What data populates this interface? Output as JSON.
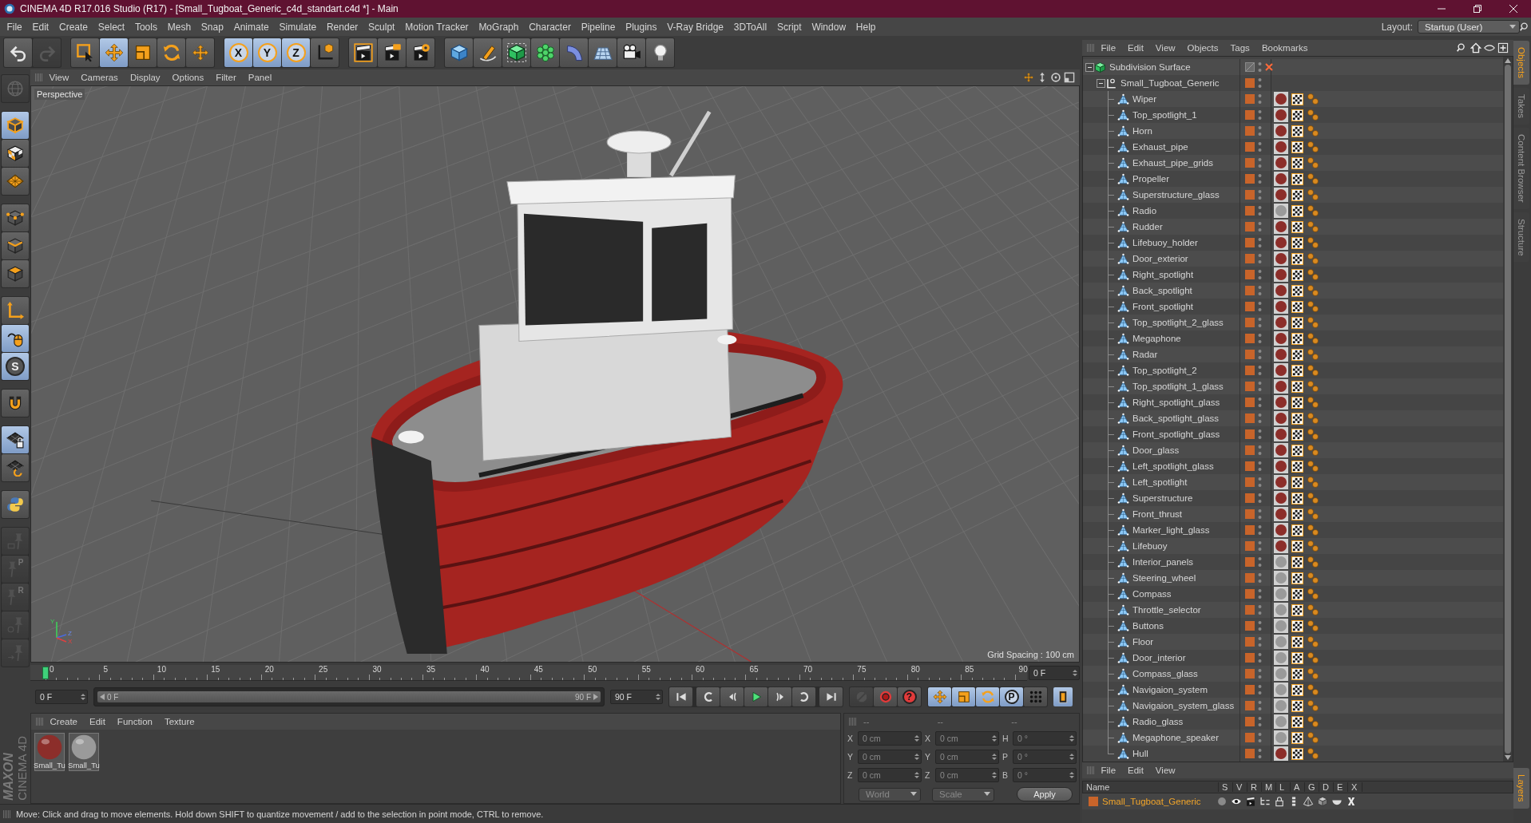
{
  "window": {
    "title": "CINEMA 4D R17.016 Studio (R17) - [Small_Tugboat_Generic_c4d_standart.c4d *] - Main"
  },
  "menu": [
    "File",
    "Edit",
    "Create",
    "Select",
    "Tools",
    "Mesh",
    "Snap",
    "Animate",
    "Simulate",
    "Render",
    "Sculpt",
    "Motion Tracker",
    "MoGraph",
    "Character",
    "Pipeline",
    "Plugins",
    "V-Ray Bridge",
    "3DToAll",
    "Script",
    "Window",
    "Help"
  ],
  "layout": {
    "label": "Layout:",
    "value": "Startup (User)"
  },
  "toolbar": [
    [
      {
        "selected": false,
        "disabled": false
      },
      {
        "selected": false,
        "disabled": true
      }
    ],
    [
      {
        "selected": false,
        "disabled": false
      },
      {
        "selected": true,
        "disabled": false
      },
      {
        "selected": false,
        "disabled": false
      },
      {
        "selected": false,
        "disabled": false
      },
      {
        "selected": false,
        "disabled": false
      }
    ],
    [
      {
        "label": "X",
        "selected": true,
        "disabled": false
      },
      {
        "label": "Y",
        "selected": true,
        "disabled": false
      },
      {
        "label": "Z",
        "selected": true,
        "disabled": false
      },
      {
        "selected": false,
        "disabled": false
      }
    ],
    [
      {
        "selected": false,
        "disabled": false
      },
      {
        "selected": false,
        "disabled": false
      },
      {
        "selected": false,
        "disabled": false
      }
    ],
    [
      {
        "selected": false,
        "disabled": false
      },
      {
        "selected": false,
        "disabled": false
      },
      {
        "selected": false,
        "disabled": false
      },
      {
        "selected": false,
        "disabled": false
      },
      {
        "selected": false,
        "disabled": false
      },
      {
        "selected": false,
        "disabled": false
      },
      {
        "selected": false,
        "disabled": false
      },
      {
        "selected": false,
        "disabled": false
      }
    ]
  ],
  "tools": [
    [
      {
        "selected": false,
        "disabled": true
      }
    ],
    [
      {
        "selected": true,
        "disabled": false
      },
      {
        "selected": false,
        "disabled": false
      },
      {
        "selected": false,
        "disabled": false
      }
    ],
    [
      {
        "selected": false,
        "disabled": false
      },
      {
        "selected": false,
        "disabled": false
      },
      {
        "selected": false,
        "disabled": false
      }
    ],
    [
      {
        "selected": false,
        "disabled": false
      },
      {
        "selected": true,
        "disabled": false
      },
      {
        "label": "S",
        "selected": true,
        "disabled": false
      }
    ],
    [
      {
        "selected": false,
        "disabled": false
      }
    ],
    [
      {
        "selected": true,
        "disabled": false
      },
      {
        "selected": false,
        "disabled": false
      }
    ],
    [
      {
        "selected": false,
        "disabled": false
      }
    ],
    [
      {
        "selected": false,
        "disabled": true
      },
      {
        "label": "P",
        "selected": false,
        "disabled": true
      },
      {
        "label": "R",
        "selected": false,
        "disabled": true
      },
      {
        "selected": false,
        "disabled": true
      },
      {
        "selected": false,
        "disabled": true
      }
    ]
  ],
  "logo": {
    "brand": "MAXON",
    "product": "CINEMA 4D"
  },
  "viewport": {
    "menu": [
      "View",
      "Cameras",
      "Display",
      "Options",
      "Filter",
      "Panel"
    ],
    "label": "Perspective",
    "grid_spacing": "Grid Spacing : 100 cm",
    "axes": [
      "Y",
      "Z",
      "X"
    ]
  },
  "timeline": {
    "ticks": [
      "0",
      "5",
      "10",
      "15",
      "20",
      "25",
      "30",
      "35",
      "40",
      "45",
      "50",
      "55",
      "60",
      "65",
      "70",
      "75",
      "80",
      "85",
      "90"
    ],
    "playhead": {
      "level": 0
    },
    "frame": "0 F"
  },
  "playback": {
    "start": "0 F",
    "range": {
      "start": "0 F",
      "end": "90 F",
      "level": 1
    },
    "end": "90 F",
    "record": [
      {
        "disabled": true
      },
      {
        "disabled": false
      },
      {
        "label": "?",
        "disabled": false
      }
    ],
    "keys": [
      {
        "selected": true
      },
      {
        "selected": true
      },
      {
        "selected": true
      },
      {
        "label": "P",
        "selected": true
      },
      {
        "selected": false
      }
    ],
    "timeline_toggle": {
      "selected": true
    }
  },
  "materials": {
    "menu": [
      "Create",
      "Edit",
      "Function",
      "Texture"
    ],
    "items": [
      {
        "name": "Small_Tu",
        "color": "#8c2e2a"
      },
      {
        "name": "Small_Tu",
        "color": "#9a9a9a"
      }
    ]
  },
  "coordinates": {
    "headers": [
      "--",
      "--",
      "--"
    ],
    "columns": [
      [
        {
          "label": "X",
          "value": "0 cm"
        },
        {
          "label": "Y",
          "value": "0 cm"
        },
        {
          "label": "Z",
          "value": "0 cm"
        }
      ],
      [
        {
          "label": "X",
          "value": "0 cm"
        },
        {
          "label": "Y",
          "value": "0 cm"
        },
        {
          "label": "Z",
          "value": "0 cm"
        }
      ],
      [
        {
          "label": "H",
          "value": "0 °"
        },
        {
          "label": "P",
          "value": "0 °"
        },
        {
          "label": "B",
          "value": "0 °"
        }
      ]
    ],
    "modes": [
      "World",
      "Scale"
    ],
    "apply": "Apply"
  },
  "status": "Move: Click and drag to move elements. Hold down SHIFT to quantize movement / add to the selection in point mode, CTRL to remove.",
  "object_manager": {
    "menu": [
      "File",
      "Edit",
      "View",
      "Objects",
      "Tags",
      "Bookmarks"
    ],
    "tree": [
      {
        "name": "Subdivision Surface",
        "kind": "generator",
        "enabled": false,
        "expanded": true,
        "children": [
          {
            "name": "Small_Tugboat_Generic",
            "kind": "null",
            "layer": {
              "color": "#c8642a"
            },
            "expanded": true,
            "children": [
              {
                "name": "Wiper",
                "kind": "polygon",
                "layer": {
                  "color": "#c8642a"
                },
                "material": {
                  "color": "#8c2e2a"
                }
              },
              {
                "name": "Top_spotlight_1",
                "kind": "polygon",
                "layer": {
                  "color": "#c8642a"
                },
                "material": {
                  "color": "#8c2e2a"
                }
              },
              {
                "name": "Horn",
                "kind": "polygon",
                "layer": {
                  "color": "#c8642a"
                },
                "material": {
                  "color": "#8c2e2a"
                }
              },
              {
                "name": "Exhaust_pipe",
                "kind": "polygon",
                "layer": {
                  "color": "#c8642a"
                },
                "material": {
                  "color": "#8c2e2a"
                }
              },
              {
                "name": "Exhaust_pipe_grids",
                "kind": "polygon",
                "layer": {
                  "color": "#c8642a"
                },
                "material": {
                  "color": "#8c2e2a"
                }
              },
              {
                "name": "Propeller",
                "kind": "polygon",
                "layer": {
                  "color": "#c8642a"
                },
                "material": {
                  "color": "#8c2e2a"
                }
              },
              {
                "name": "Superstructure_glass",
                "kind": "polygon",
                "layer": {
                  "color": "#c8642a"
                },
                "material": {
                  "color": "#8c2e2a"
                }
              },
              {
                "name": "Radio",
                "kind": "polygon",
                "layer": {
                  "color": "#c8642a"
                },
                "material": {
                  "color": "#9a9a9a"
                }
              },
              {
                "name": "Rudder",
                "kind": "polygon",
                "layer": {
                  "color": "#c8642a"
                },
                "material": {
                  "color": "#8c2e2a"
                }
              },
              {
                "name": "Lifebuoy_holder",
                "kind": "polygon",
                "layer": {
                  "color": "#c8642a"
                },
                "material": {
                  "color": "#8c2e2a"
                }
              },
              {
                "name": "Door_exterior",
                "kind": "polygon",
                "layer": {
                  "color": "#c8642a"
                },
                "material": {
                  "color": "#8c2e2a"
                }
              },
              {
                "name": "Right_spotlight",
                "kind": "polygon",
                "layer": {
                  "color": "#c8642a"
                },
                "material": {
                  "color": "#8c2e2a"
                }
              },
              {
                "name": "Back_spotlight",
                "kind": "polygon",
                "layer": {
                  "color": "#c8642a"
                },
                "material": {
                  "color": "#8c2e2a"
                }
              },
              {
                "name": "Front_spotlight",
                "kind": "polygon",
                "layer": {
                  "color": "#c8642a"
                },
                "material": {
                  "color": "#8c2e2a"
                }
              },
              {
                "name": "Top_spotlight_2_glass",
                "kind": "polygon",
                "layer": {
                  "color": "#c8642a"
                },
                "material": {
                  "color": "#8c2e2a"
                }
              },
              {
                "name": "Megaphone",
                "kind": "polygon",
                "layer": {
                  "color": "#c8642a"
                },
                "material": {
                  "color": "#8c2e2a"
                }
              },
              {
                "name": "Radar",
                "kind": "polygon",
                "layer": {
                  "color": "#c8642a"
                },
                "material": {
                  "color": "#8c2e2a"
                }
              },
              {
                "name": "Top_spotlight_2",
                "kind": "polygon",
                "layer": {
                  "color": "#c8642a"
                },
                "material": {
                  "color": "#8c2e2a"
                }
              },
              {
                "name": "Top_spotlight_1_glass",
                "kind": "polygon",
                "layer": {
                  "color": "#c8642a"
                },
                "material": {
                  "color": "#8c2e2a"
                }
              },
              {
                "name": "Right_spotlight_glass",
                "kind": "polygon",
                "layer": {
                  "color": "#c8642a"
                },
                "material": {
                  "color": "#8c2e2a"
                }
              },
              {
                "name": "Back_spotlight_glass",
                "kind": "polygon",
                "layer": {
                  "color": "#c8642a"
                },
                "material": {
                  "color": "#8c2e2a"
                }
              },
              {
                "name": "Front_spotlight_glass",
                "kind": "polygon",
                "layer": {
                  "color": "#c8642a"
                },
                "material": {
                  "color": "#8c2e2a"
                }
              },
              {
                "name": "Door_glass",
                "kind": "polygon",
                "layer": {
                  "color": "#c8642a"
                },
                "material": {
                  "color": "#8c2e2a"
                }
              },
              {
                "name": "Left_spotlight_glass",
                "kind": "polygon",
                "layer": {
                  "color": "#c8642a"
                },
                "material": {
                  "color": "#8c2e2a"
                }
              },
              {
                "name": "Left_spotlight",
                "kind": "polygon",
                "layer": {
                  "color": "#c8642a"
                },
                "material": {
                  "color": "#8c2e2a"
                }
              },
              {
                "name": "Superstructure",
                "kind": "polygon",
                "layer": {
                  "color": "#c8642a"
                },
                "material": {
                  "color": "#8c2e2a"
                }
              },
              {
                "name": "Front_thrust",
                "kind": "polygon",
                "layer": {
                  "color": "#c8642a"
                },
                "material": {
                  "color": "#8c2e2a"
                }
              },
              {
                "name": "Marker_light_glass",
                "kind": "polygon",
                "layer": {
                  "color": "#c8642a"
                },
                "material": {
                  "color": "#8c2e2a"
                }
              },
              {
                "name": "Lifebuoy",
                "kind": "polygon",
                "layer": {
                  "color": "#c8642a"
                },
                "material": {
                  "color": "#8c2e2a"
                }
              },
              {
                "name": "Interior_panels",
                "kind": "polygon",
                "layer": {
                  "color": "#c8642a"
                },
                "material": {
                  "color": "#9a9a9a"
                }
              },
              {
                "name": "Steering_wheel",
                "kind": "polygon",
                "layer": {
                  "color": "#c8642a"
                },
                "material": {
                  "color": "#9a9a9a"
                }
              },
              {
                "name": "Compass",
                "kind": "polygon",
                "layer": {
                  "color": "#c8642a"
                },
                "material": {
                  "color": "#9a9a9a"
                }
              },
              {
                "name": "Throttle_selector",
                "kind": "polygon",
                "layer": {
                  "color": "#c8642a"
                },
                "material": {
                  "color": "#9a9a9a"
                }
              },
              {
                "name": "Buttons",
                "kind": "polygon",
                "layer": {
                  "color": "#c8642a"
                },
                "material": {
                  "color": "#9a9a9a"
                }
              },
              {
                "name": "Floor",
                "kind": "polygon",
                "layer": {
                  "color": "#c8642a"
                },
                "material": {
                  "color": "#9a9a9a"
                }
              },
              {
                "name": "Door_interior",
                "kind": "polygon",
                "layer": {
                  "color": "#c8642a"
                },
                "material": {
                  "color": "#9a9a9a"
                }
              },
              {
                "name": "Compass_glass",
                "kind": "polygon",
                "layer": {
                  "color": "#c8642a"
                },
                "material": {
                  "color": "#9a9a9a"
                }
              },
              {
                "name": "Navigaion_system",
                "kind": "polygon",
                "layer": {
                  "color": "#c8642a"
                },
                "material": {
                  "color": "#9a9a9a"
                }
              },
              {
                "name": "Navigaion_system_glass",
                "kind": "polygon",
                "layer": {
                  "color": "#c8642a"
                },
                "material": {
                  "color": "#9a9a9a"
                }
              },
              {
                "name": "Radio_glass",
                "kind": "polygon",
                "layer": {
                  "color": "#c8642a"
                },
                "material": {
                  "color": "#9a9a9a"
                }
              },
              {
                "name": "Megaphone_speaker",
                "kind": "polygon",
                "layer": {
                  "color": "#c8642a"
                },
                "material": {
                  "color": "#9a9a9a"
                }
              },
              {
                "name": "Hull",
                "kind": "polygon",
                "layer": {
                  "color": "#c8642a"
                },
                "material": {
                  "color": "#8c2e2a"
                }
              }
            ]
          }
        ]
      }
    ]
  },
  "side_tabs": [
    {
      "label": "Objects",
      "selected": true
    },
    {
      "label": "Takes",
      "selected": false
    },
    {
      "label": "Content Browser",
      "selected": false
    },
    {
      "label": "Structure",
      "selected": false
    }
  ],
  "layer_manager": {
    "menu": [
      "File",
      "Edit",
      "View"
    ],
    "columns": [
      "Name",
      "S",
      "V",
      "R",
      "M",
      "L",
      "A",
      "G",
      "D",
      "E",
      "X"
    ],
    "rows": [
      {
        "name": "Small_Tugboat_Generic",
        "color": "#c8642a"
      }
    ],
    "tab": {
      "label": "Layers",
      "selected": true
    }
  }
}
